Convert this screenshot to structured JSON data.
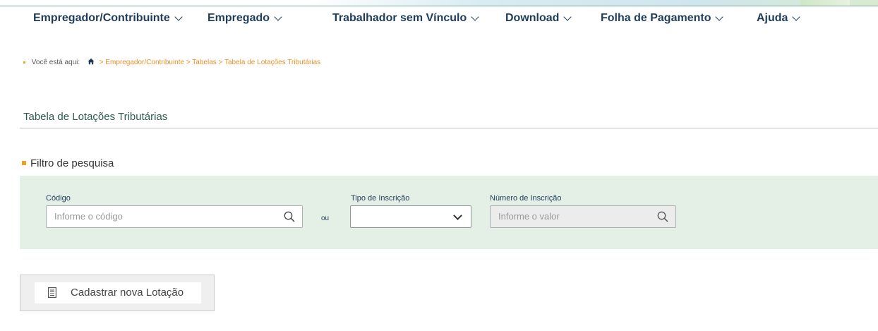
{
  "menu": {
    "items": [
      {
        "label": "Empregador/Contribuinte"
      },
      {
        "label": "Empregado"
      },
      {
        "label": "Trabalhador sem Vínculo"
      },
      {
        "label": "Download"
      },
      {
        "label": "Folha de Pagamento"
      },
      {
        "label": "Ajuda"
      }
    ]
  },
  "breadcrumb": {
    "prefix": "Você está aqui:",
    "path": "> Empregador/Contribuinte > Tabelas > Tabela de Lotações Tributárias"
  },
  "page": {
    "title": "Tabela de Lotações Tributárias"
  },
  "filter": {
    "heading": "Filtro de pesquisa",
    "codigo": {
      "label": "Código",
      "placeholder": "Informe o código"
    },
    "separator": "ou",
    "tipo_inscricao": {
      "label": "Tipo de Inscrição",
      "value": ""
    },
    "numero_inscricao": {
      "label": "Número de Inscrição",
      "placeholder": "Informe o valor"
    }
  },
  "actions": {
    "cadastrar_label": "Cadastrar nova Lotação"
  },
  "colors": {
    "menu_text": "#1f3c5a",
    "breadcrumb_link": "#e8902c",
    "bullet": "#f0a020",
    "filter_panel_bg": "#e4efe6",
    "title_text": "#2f5a50"
  }
}
